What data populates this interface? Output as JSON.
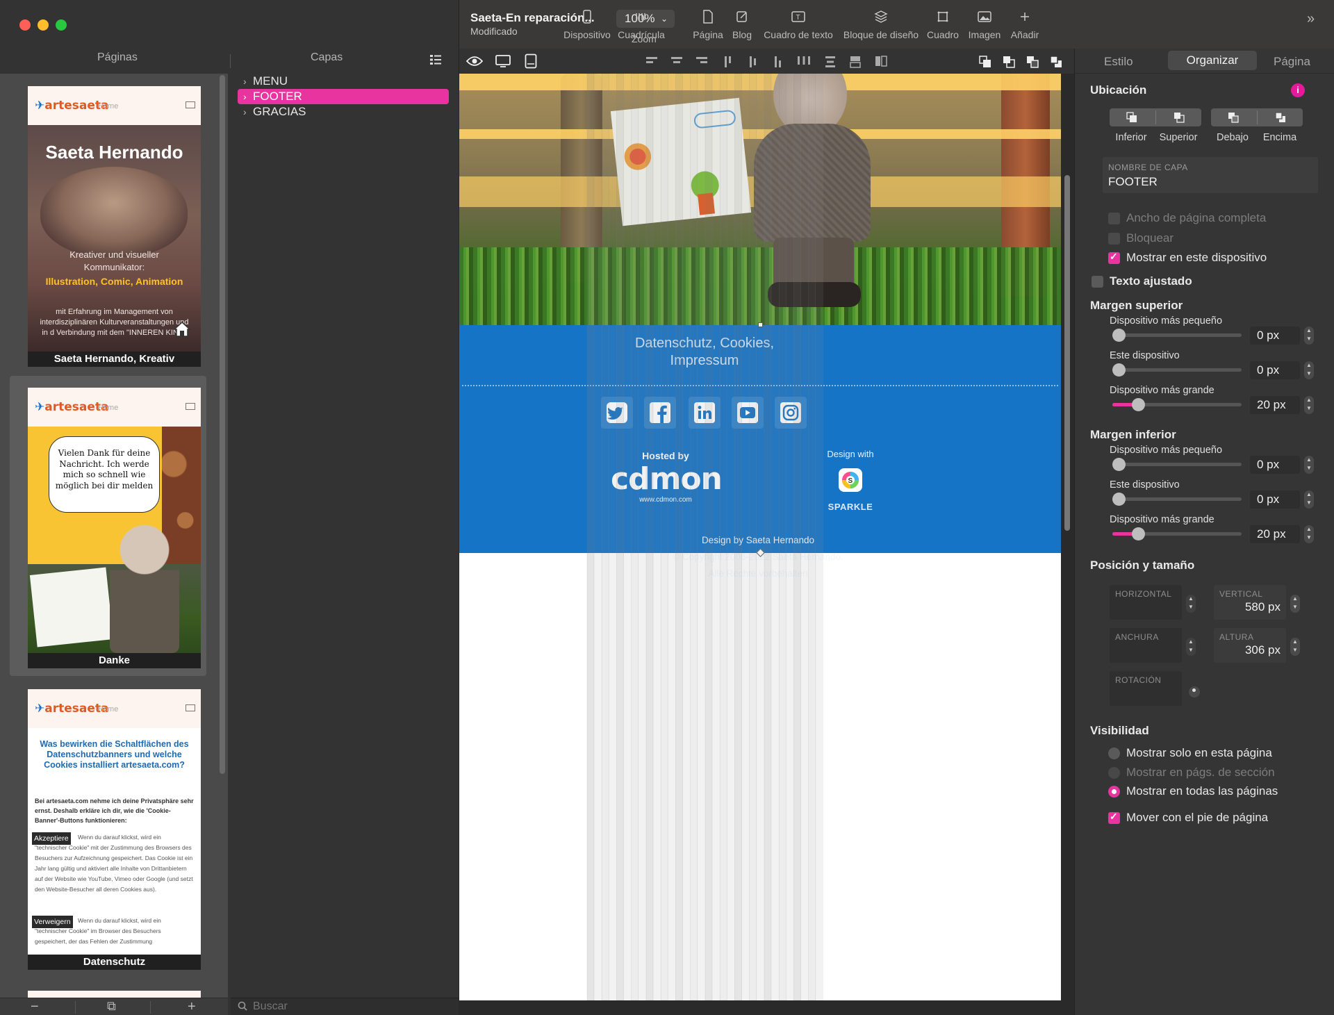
{
  "window": {
    "traffic_colors": [
      "#ff5f57",
      "#febc2e",
      "#28c840"
    ]
  },
  "left_tabs": {
    "pages": "Páginas",
    "layers": "Capas"
  },
  "pages": [
    {
      "caption": "Saeta Hernando, Kreativ",
      "logo": "artesaeta",
      "home": "Home",
      "title": "Saeta Hernando",
      "sub": "Kreativer und visueller Kommunikator:",
      "highlight": "Illustration, Comic, Animation",
      "small": "mit Erfahrung im Management von interdisziplinären Kulturveranstaltungen und in d Verbindung mit dem \"INNEREN KIND\""
    },
    {
      "caption": "Danke",
      "logo": "artesaeta",
      "home": "Home",
      "bubble": "Vielen Dank für deine Nachricht. Ich werde mich so schnell wie möglich bei dir melden"
    },
    {
      "caption": "Datenschutz",
      "logo": "artesaeta",
      "home": "Home",
      "title": "Was bewirken die Schaltflächen des Datenschutzbanners und welche Cookies installiert artesaeta.com?",
      "intro": "Bei artesaeta.com nehme ich deine Privatsphäre sehr ernst. Deshalb erkläre ich dir, wie die 'Cookie-Banner'-Buttons funktionieren:",
      "btn1": "Akzeptiere",
      "text1": "Wenn du darauf klickst, wird ein \"technischer Cookie\" mit der Zustimmung des Browsers des Besuchers zur Aufzeichnung gespeichert. Das Cookie ist ein Jahr lang gültig und aktiviert alle Inhalte von Drittanbietern auf der Website wie YouTube, Vimeo oder Google (und setzt den Website-Besucher all deren Cookies aus).",
      "btn2": "Verweigern",
      "text2": "Wenn du darauf klickst, wird ein \"technischer Cookie\" im Browser des Besuchers gespeichert, der das Fehlen der Zustimmung"
    }
  ],
  "pages_toolbar": {
    "remove": "−",
    "duplicate": "⧉",
    "add": "+"
  },
  "layers": [
    {
      "name": "MENU",
      "selected": false
    },
    {
      "name": "FOOTER",
      "selected": true
    },
    {
      "name": "GRACIAS",
      "selected": false
    }
  ],
  "layers_search_placeholder": "Buscar",
  "toolbar": {
    "title": "Saeta-En reparación...",
    "status": "Modificado",
    "zoom_value": "100%",
    "zoom_label": "Zoom",
    "tools": [
      {
        "label": "Dispositivo",
        "icon": "device-icon"
      },
      {
        "label": "Cuadrícula",
        "icon": "grid-icon"
      },
      {
        "label": "Página",
        "icon": "page-icon"
      },
      {
        "label": "Blog",
        "icon": "blog-icon"
      },
      {
        "label": "Cuadro de texto",
        "icon": "textbox-icon"
      },
      {
        "label": "Bloque de diseño",
        "icon": "layers-icon"
      },
      {
        "label": "Cuadro",
        "icon": "box-icon"
      },
      {
        "label": "Imagen",
        "icon": "image-icon"
      },
      {
        "label": "Añadir",
        "icon": "plus-icon"
      }
    ],
    "more": "»"
  },
  "canvas": {
    "footer_links": "Datenschutz, Cookies, Impressum",
    "hosted_by": "Hosted by",
    "cdmon": "cdmon",
    "cdmon_url": "www.cdmon.com",
    "design_with": "Design with",
    "sparkle": "SPARKLE",
    "credits": [
      "Design by Saeta Hernando",
      "© Copyright 2006-2022 Saeta Hernando.",
      "Alle Rechte vorbehalten"
    ],
    "social_icons": [
      "twitter-icon",
      "facebook-icon",
      "linkedin-icon",
      "youtube-icon",
      "instagram-icon"
    ],
    "footer_color": "#1674c6"
  },
  "inspector": {
    "tabs": {
      "style": "Estilo",
      "arrange": "Organizar",
      "page": "Página"
    },
    "ubicacion": {
      "title": "Ubicación",
      "buttons": [
        "Inferior",
        "Superior",
        "Debajo",
        "Encima"
      ]
    },
    "layer_name": {
      "caption": "NOMBRE DE CAPA",
      "value": "FOOTER"
    },
    "checks": [
      {
        "label": "Ancho de página completa",
        "checked": false,
        "enabled": false
      },
      {
        "label": "Bloquear",
        "checked": false,
        "enabled": false
      },
      {
        "label": "Mostrar en este dispositivo",
        "checked": true,
        "enabled": true
      }
    ],
    "texto_ajustado": {
      "label": "Texto ajustado",
      "checked": false
    },
    "margen_superior": {
      "title": "Margen superior",
      "rows": [
        {
          "label": "Dispositivo más pequeño",
          "value": "0 px",
          "fraction": 0
        },
        {
          "label": "Este dispositivo",
          "value": "0 px",
          "fraction": 0
        },
        {
          "label": "Dispositivo más grande",
          "value": "20 px",
          "fraction": 0.2
        }
      ]
    },
    "margen_inferior": {
      "title": "Margen inferior",
      "rows": [
        {
          "label": "Dispositivo más pequeño",
          "value": "0 px",
          "fraction": 0
        },
        {
          "label": "Este dispositivo",
          "value": "0 px",
          "fraction": 0
        },
        {
          "label": "Dispositivo más grande",
          "value": "20 px",
          "fraction": 0.2
        }
      ]
    },
    "posicion": {
      "title": "Posición y tamaño",
      "horizontal": {
        "caption": "HORIZONTAL",
        "value": ""
      },
      "vertical": {
        "caption": "VERTICAL",
        "value": "580 px"
      },
      "anchura": {
        "caption": "ANCHURA",
        "value": ""
      },
      "altura": {
        "caption": "ALTURA",
        "value": "306 px"
      },
      "rotacion": {
        "caption": "ROTACIÓN",
        "value": ""
      }
    },
    "visibilidad": {
      "title": "Visibilidad",
      "options": [
        {
          "label": "Mostrar solo en esta página",
          "selected": false,
          "enabled": true
        },
        {
          "label": "Mostrar en págs. de sección",
          "selected": false,
          "enabled": false
        },
        {
          "label": "Mostrar en todas las páginas",
          "selected": true,
          "enabled": true
        }
      ],
      "move_with_footer": {
        "label": "Mover con el pie de página",
        "checked": true
      }
    },
    "accent": "#e8349e"
  }
}
